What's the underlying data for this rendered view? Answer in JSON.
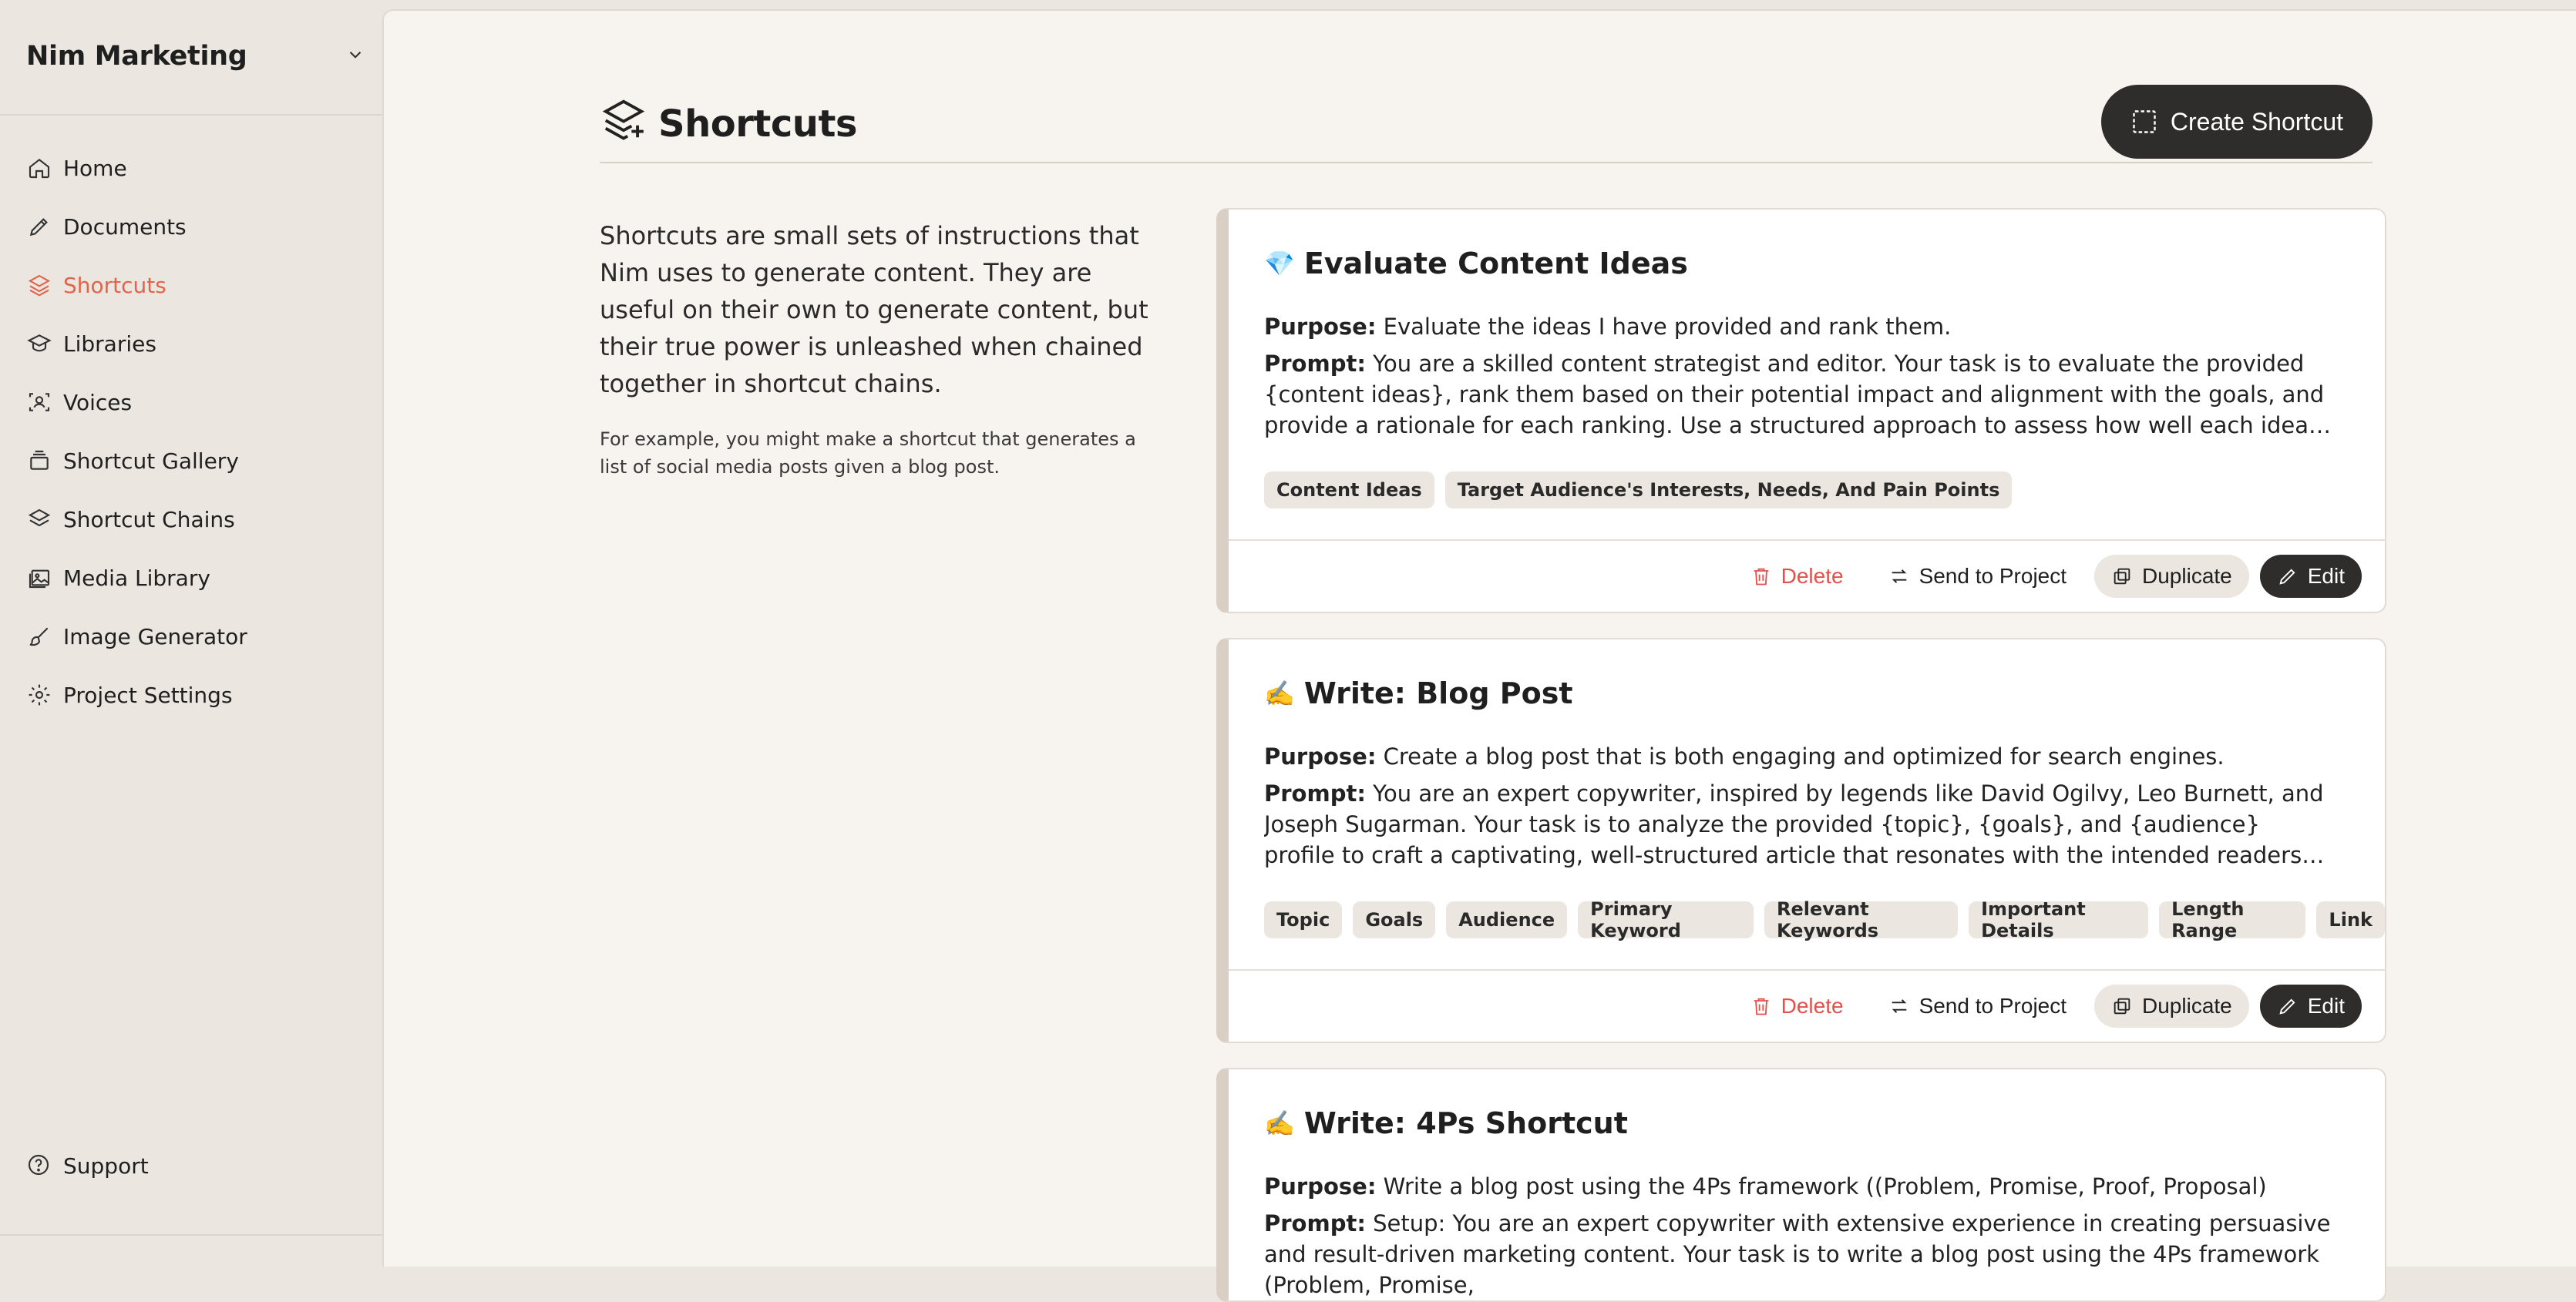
{
  "sidebar": {
    "workspace": "Nim Marketing",
    "items": [
      {
        "label": "Home",
        "icon": "home-icon"
      },
      {
        "label": "Documents",
        "icon": "pen-nib-icon"
      },
      {
        "label": "Shortcuts",
        "icon": "layers-icon",
        "active": true
      },
      {
        "label": "Libraries",
        "icon": "graduation-cap-icon"
      },
      {
        "label": "Voices",
        "icon": "voice-scan-icon"
      },
      {
        "label": "Shortcut Gallery",
        "icon": "gallery-stack-icon"
      },
      {
        "label": "Shortcut Chains",
        "icon": "chains-icon"
      },
      {
        "label": "Media Library",
        "icon": "image-library-icon"
      },
      {
        "label": "Image Generator",
        "icon": "brush-icon"
      },
      {
        "label": "Project Settings",
        "icon": "gear-icon"
      }
    ],
    "support": "Support"
  },
  "header": {
    "title": "Shortcuts",
    "create_label": "Create Shortcut"
  },
  "intro": {
    "lead": "Shortcuts are small sets of instructions that Nim uses to generate content. They are useful on their own to generate content, but their true power is unleashed when chained together in shortcut chains.",
    "example": "For example, you might make a shortcut that generates a list of social media posts given a blog post."
  },
  "labels": {
    "purpose": "Purpose:",
    "prompt": "Prompt:",
    "delete": "Delete",
    "send": "Send to Project",
    "duplicate": "Duplicate",
    "edit": "Edit"
  },
  "cards": [
    {
      "emoji": "💎",
      "title": "Evaluate Content Ideas",
      "purpose": "Evaluate the ideas I have provided and rank them.",
      "prompt": "You are a skilled content strategist and editor. Your task is to evaluate the provided {content ideas}, rank them based on their potential impact and alignment with the goals, and provide a rationale for each ranking. Use a structured approach to assess how well each idea would engage the target audience and...",
      "tags": [
        "Content Ideas",
        "Target Audience's Interests, Needs, And Pain Points"
      ]
    },
    {
      "emoji": "✍️",
      "title": "Write: Blog Post",
      "purpose": "Create a blog post that is both engaging and optimized for search engines.",
      "prompt": "You are an expert copywriter, inspired by legends like David Ogilvy, Leo Burnett, and Joseph Sugarman. Your task is to analyze the provided {topic}, {goals}, and {audience} profile to craft a captivating, well-structured article that resonates with the intended readers and drives them to act on the call to actio...",
      "tags": [
        "Topic",
        "Goals",
        "Audience",
        "Primary Keyword",
        "Relevant Keywords",
        "Important Details",
        "Length Range",
        "Link"
      ]
    },
    {
      "emoji": "✍️",
      "title": "Write: 4Ps Shortcut",
      "purpose": "Write a blog post using the 4Ps framework ((Problem, Promise, Proof, Proposal)",
      "prompt": "Setup: You are an expert copywriter with extensive experience in creating persuasive and result-driven marketing content. Your task is to write a blog post using the 4Ps framework (Problem, Promise,"
    }
  ]
}
